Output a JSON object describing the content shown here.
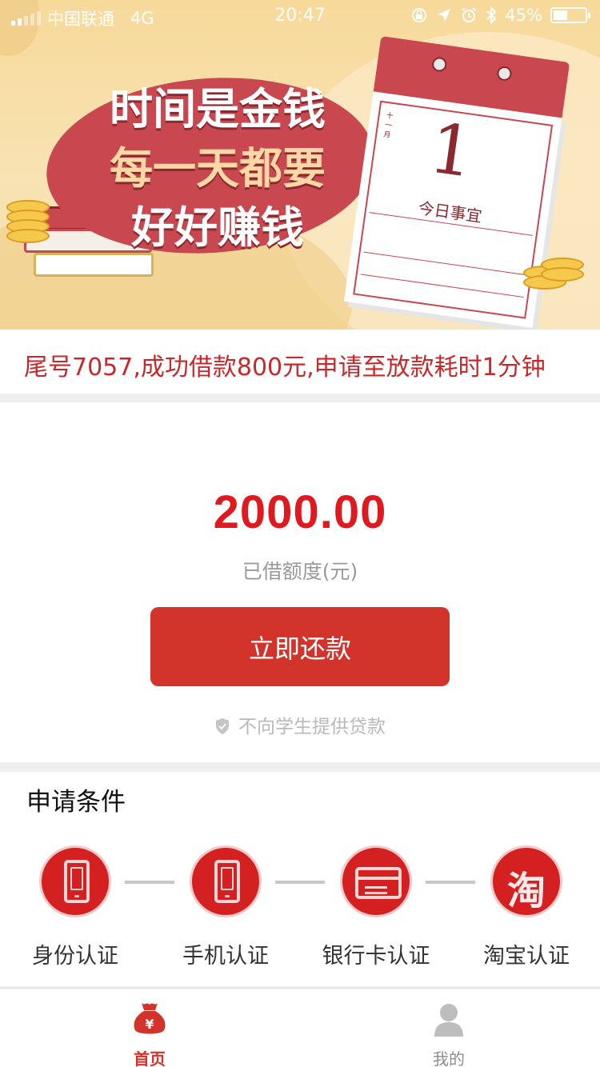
{
  "status_bar": {
    "carrier": "中国联通",
    "network": "4G",
    "time": "20:47",
    "battery_text": "45%",
    "battery_level": 0.45
  },
  "banner": {
    "slogan_line1": "时间是金钱",
    "slogan_line2": "每一天都要",
    "slogan_line3": "好好赚钱",
    "calendar_day": "1",
    "calendar_caption": "今日事宜"
  },
  "ticker": {
    "text": "尾号7057,成功借款800元,申请至放款耗时1分钟"
  },
  "credit": {
    "amount": "2000.00",
    "amount_label": "已借额度(元)",
    "repay_label": "立即还款",
    "notice": "不向学生提供贷款"
  },
  "conditions": {
    "title": "申请条件",
    "items": [
      {
        "label": "身份认证",
        "icon": "id-card-icon"
      },
      {
        "label": "手机认证",
        "icon": "phone-icon"
      },
      {
        "label": "银行卡认证",
        "icon": "bank-card-icon"
      },
      {
        "label": "淘宝认证",
        "icon": "taobao-icon",
        "glyph": "淘"
      }
    ]
  },
  "tab_bar": {
    "home_label": "首页",
    "mine_label": "我的"
  },
  "colors": {
    "primary_red": "#d2332b",
    "amount_red": "#e0191f",
    "ticker_red": "#c8282a"
  }
}
